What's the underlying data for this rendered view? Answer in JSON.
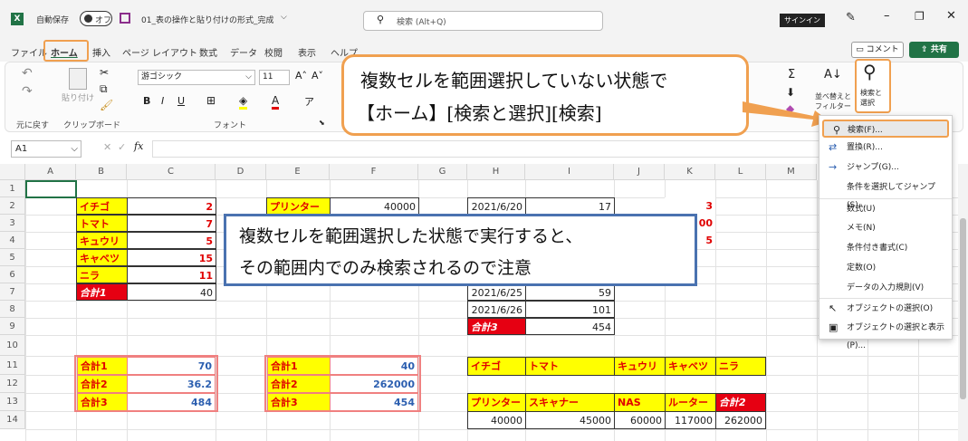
{
  "titlebar": {
    "autosave": "自動保存",
    "toggle": "オフ",
    "filename": "01_表の操作と貼り付けの形式_完成",
    "search": "検索 (Alt+Q)",
    "signin": "サインイン"
  },
  "tabs": [
    "ファイル",
    "ホーム",
    "挿入",
    "ページ レイアウト",
    "数式",
    "データ",
    "校閲",
    "表示",
    "ヘルプ"
  ],
  "rightbtns": {
    "comment": "コメント",
    "share": "共有"
  },
  "ribbon": {
    "undo": "元に戻す",
    "paste": "貼り付け",
    "clipboard": "クリップボード",
    "font_name": "游ゴシック",
    "font_size": "11",
    "font": "フォント",
    "sort": "並べ替えと",
    "sort2": "フィルター",
    "find": "検索と",
    "find2": "選択"
  },
  "namebox": "A1",
  "columns": [
    "A",
    "B",
    "C",
    "D",
    "E",
    "F",
    "G",
    "H",
    "I",
    "J",
    "K",
    "L",
    "M"
  ],
  "rows": [
    "1",
    "2",
    "3",
    "4",
    "5",
    "6",
    "7",
    "8",
    "9",
    "10",
    "11",
    "12",
    "13",
    "14"
  ],
  "table1": {
    "labels": [
      "イチゴ",
      "トマト",
      "キュウリ",
      "キャベツ",
      "ニラ"
    ],
    "values": [
      "2",
      "7",
      "5",
      "15",
      "11"
    ],
    "total_label": "合計1",
    "total_value": "40"
  },
  "table2": {
    "label": "プリンター",
    "value": "40000"
  },
  "table3": {
    "dates": [
      "2021/6/20",
      "2021/6/25",
      "2021/6/26"
    ],
    "values": [
      "17",
      "59",
      "101"
    ],
    "total_label": "合計3",
    "total_value": "454"
  },
  "kvals": [
    "3",
    "00",
    "5"
  ],
  "summary1": {
    "labels": [
      "合計1",
      "合計2",
      "合計3"
    ],
    "values": [
      "70",
      "36.2",
      "484"
    ]
  },
  "summary2": {
    "labels": [
      "合計1",
      "合計2",
      "合計3"
    ],
    "values": [
      "40",
      "262000",
      "454"
    ]
  },
  "row11": [
    "イチゴ",
    "トマト",
    "キュウリ",
    "キャベツ",
    "ニラ"
  ],
  "row13": [
    "プリンター",
    "スキャナー",
    "NAS",
    "ルーター",
    "合計2"
  ],
  "row14": [
    "40000",
    "45000",
    "60000",
    "117000",
    "262000"
  ],
  "callout1": {
    "line1": "複数セルを範囲選択していない状態で",
    "line2": "【ホーム】[検索と選択][検索]"
  },
  "callout2": {
    "line1": "複数セルを範囲選択した状態で実行すると、",
    "line2": "その範囲内でのみ検索されるので注意"
  },
  "menu": [
    "検索(F)...",
    "置換(R)...",
    "ジャンプ(G)...",
    "条件を選択してジャンプ(S)...",
    "数式(U)",
    "メモ(N)",
    "条件付き書式(C)",
    "定数(O)",
    "データの入力規則(V)",
    "オブジェクトの選択(O)",
    "オブジェクトの選択と表示(P)..."
  ],
  "colors": {
    "accent": "#f0a050",
    "green": "#217346",
    "callout2_border": "#4a72b0"
  }
}
